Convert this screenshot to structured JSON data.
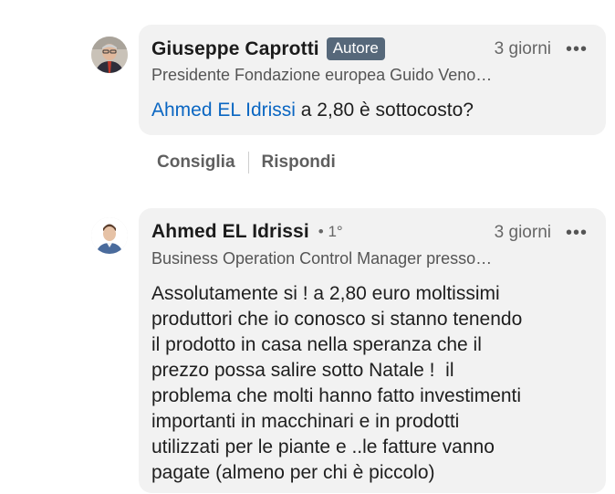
{
  "comments": [
    {
      "author": "Giuseppe Caprotti",
      "badge": "Autore",
      "time": "3 giorni",
      "more": "•••",
      "headline": "Presidente Fondazione europea Guido Veno…",
      "mention": "Ahmed EL Idrissi",
      "text": " a 2,80 è sottocosto?",
      "actions": {
        "like": "Consiglia",
        "reply": "Rispondi"
      }
    },
    {
      "author": "Ahmed EL Idrissi",
      "degree": "• 1°",
      "time": "3 giorni",
      "more": "•••",
      "headline": "Business Operation Control Manager presso…",
      "lines": [
        "Assolutamente si ! a 2,80 euro moltissimi",
        "produttori che io conosco si stanno tenendo",
        "il prodotto in casa nella speranza che il",
        "prezzo possa salire sotto Natale !  il",
        "problema che molti hanno fatto investimenti",
        "importanti in macchinari e in prodotti",
        "utilizzati per le piante e ..le fatture vanno",
        "pagate (almeno per chi è piccolo)"
      ]
    }
  ],
  "colors": {
    "bubble": "#f2f2f2",
    "badge": "#56687a",
    "mention": "#0a66c2"
  }
}
